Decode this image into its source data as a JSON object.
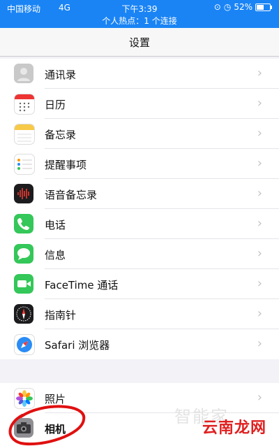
{
  "status_bar": {
    "carrier": "中国移动",
    "network": "4G",
    "time": "下午3:39",
    "battery_percent": "52%",
    "battery_level": 0.52,
    "hotspot": "个人热点：1 个连接",
    "background": "#1a84f5"
  },
  "nav": {
    "title": "设置"
  },
  "group1": [
    {
      "label": "通讯录",
      "icon": "contacts-icon"
    },
    {
      "label": "日历",
      "icon": "calendar-icon"
    },
    {
      "label": "备忘录",
      "icon": "notes-icon"
    },
    {
      "label": "提醒事项",
      "icon": "reminders-icon"
    },
    {
      "label": "语音备忘录",
      "icon": "voice-memos-icon"
    },
    {
      "label": "电话",
      "icon": "phone-icon"
    },
    {
      "label": "信息",
      "icon": "messages-icon"
    },
    {
      "label": "FaceTime 通话",
      "icon": "facetime-icon"
    },
    {
      "label": "指南针",
      "icon": "compass-icon"
    },
    {
      "label": "Safari 浏览器",
      "icon": "safari-icon"
    }
  ],
  "group2": [
    {
      "label": "照片",
      "icon": "photos-icon"
    },
    {
      "label": "相机",
      "icon": "camera-icon"
    }
  ],
  "chevron": "›",
  "watermark": {
    "text": "云南龙网",
    "ghost": "智能家",
    "color": "#e02020"
  }
}
